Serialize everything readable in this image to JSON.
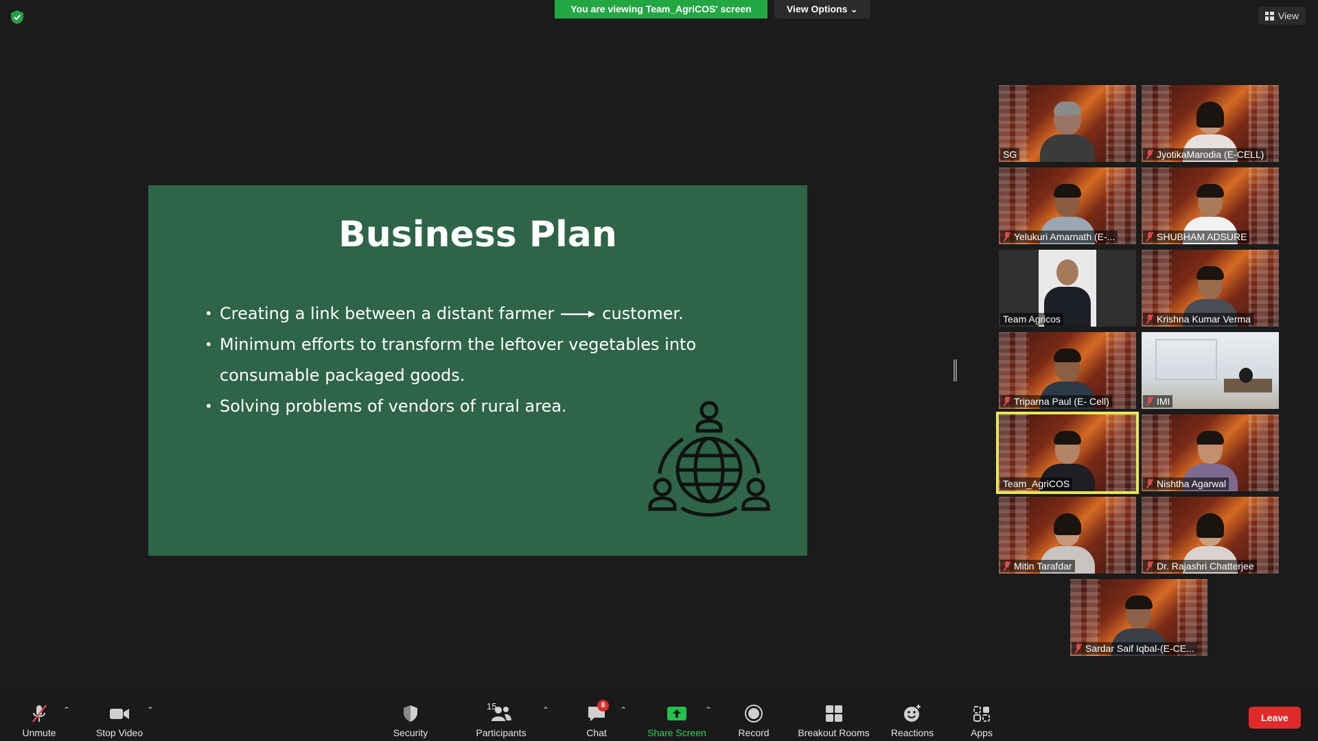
{
  "banner": {
    "viewing_text": "You are viewing Team_AgriCOS' screen",
    "view_options_label": "View Options"
  },
  "top_right": {
    "view_label": "View"
  },
  "slide": {
    "title": "Business Plan",
    "bullet1_a": "Creating a link between a distant farmer",
    "bullet1_b": "customer.",
    "bullet2": "Minimum efforts to transform the leftover vegetables into consumable packaged goods.",
    "bullet3": "Solving problems of vendors of rural area.",
    "background_color": "#2e6448"
  },
  "participants": [
    {
      "name": "SG",
      "muted": false
    },
    {
      "name": "JyotikaMarodia (E-CELL)",
      "muted": true
    },
    {
      "name": "Yelukuri Amarnath (E-...",
      "muted": true
    },
    {
      "name": "SHUBHAM ADSURE",
      "muted": true
    },
    {
      "name": "Team Agricos",
      "muted": false
    },
    {
      "name": "Krishna Kumar Verma",
      "muted": true
    },
    {
      "name": "Triparna Paul (E- Cell)",
      "muted": true
    },
    {
      "name": "IMI",
      "muted": true
    },
    {
      "name": "Team_AgriCOS",
      "muted": false,
      "active_speaker": true
    },
    {
      "name": "Nishtha Agarwal",
      "muted": true
    },
    {
      "name": "Mitin Tarafdar",
      "muted": true
    },
    {
      "name": "Dr. Rajashri Chatterjee",
      "muted": true
    },
    {
      "name": "Sardar Saif Iqbal-(E-CE...",
      "muted": true
    }
  ],
  "toolbar": {
    "unmute": "Unmute",
    "stop_video": "Stop Video",
    "security": "Security",
    "participants": "Participants",
    "participants_count": "15",
    "chat": "Chat",
    "chat_badge": "8",
    "share_screen": "Share Screen",
    "record": "Record",
    "breakout_rooms": "Breakout Rooms",
    "reactions": "Reactions",
    "apps": "Apps",
    "leave": "Leave"
  },
  "colors": {
    "banner_green": "#23a743",
    "leave_red": "#e02a2a",
    "active_speaker": "#e6e65a",
    "share_green": "#35d35c"
  }
}
